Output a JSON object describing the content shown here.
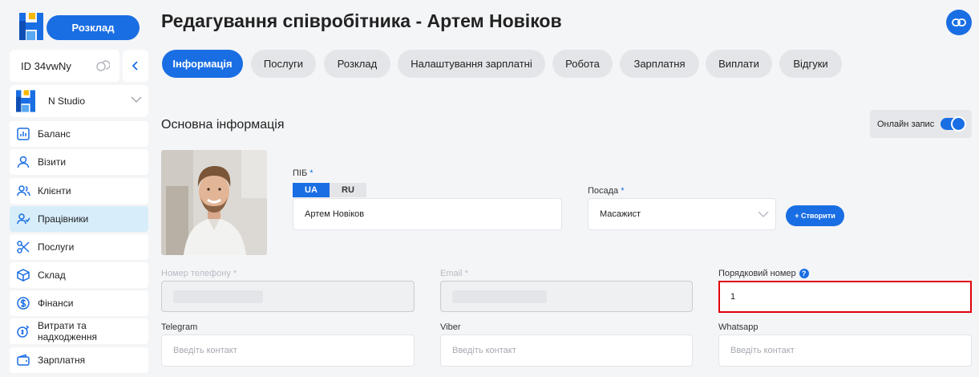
{
  "sidebar": {
    "schedule_button": "Розклад",
    "account_id": "ID 34vwNy",
    "studio_name": "N Studio",
    "items": [
      {
        "label": "Баланс",
        "icon": "chart-icon"
      },
      {
        "label": "Візити",
        "icon": "user-icon"
      },
      {
        "label": "Клієнти",
        "icon": "users-icon"
      },
      {
        "label": "Працівники",
        "icon": "user-check-icon"
      },
      {
        "label": "Послуги",
        "icon": "scissors-icon"
      },
      {
        "label": "Склад",
        "icon": "box-icon"
      },
      {
        "label": "Фінанси",
        "icon": "dollar-icon"
      },
      {
        "label": "Витрати та надходження",
        "icon": "coins-icon"
      },
      {
        "label": "Зарплатня",
        "icon": "wallet-icon"
      }
    ]
  },
  "page": {
    "title": "Редагування співробітника - Артем Новіков"
  },
  "tabs": [
    {
      "label": "Інформація"
    },
    {
      "label": "Послуги"
    },
    {
      "label": "Розклад"
    },
    {
      "label": "Налаштування зарплатні"
    },
    {
      "label": "Робота"
    },
    {
      "label": "Зарплатня"
    },
    {
      "label": "Виплати"
    },
    {
      "label": "Відгуки"
    }
  ],
  "form": {
    "section_title": "Основна інформація",
    "online_booking_label": "Онлайн запис",
    "online_booking_enabled": true,
    "name_label": "ПІБ",
    "lang_ua": "UA",
    "lang_ru": "RU",
    "name_value": "Артем Новіков",
    "position_label": "Посада",
    "position_value": "Масажист",
    "create_button": "+ Створити",
    "phone_label": "Номер телефону",
    "email_label": "Email",
    "order_label": "Порядковий номер",
    "order_value": "1",
    "help_icon": "?",
    "telegram_label": "Telegram",
    "viber_label": "Viber",
    "whatsapp_label": "Whatsapp",
    "contact_placeholder": "Введіть контакт",
    "required_mark": "*"
  },
  "colors": {
    "accent": "#1a6ee3",
    "highlight": "#e0000b",
    "active_nav": "#d7edfa"
  }
}
